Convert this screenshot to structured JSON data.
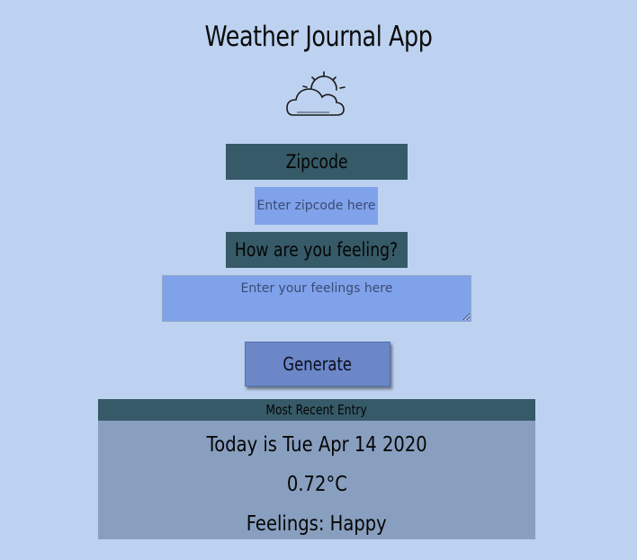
{
  "app": {
    "title": "Weather Journal App",
    "logo_icon": "partly-cloudy-icon"
  },
  "form": {
    "zip_label": "Zipcode",
    "zip_placeholder": "Enter zipcode here",
    "zip_value": "",
    "feelings_label": "How are you feeling?",
    "feelings_placeholder": "Enter your feelings here",
    "feelings_value": "",
    "generate_label": "Generate"
  },
  "entry": {
    "header": "Most Recent Entry",
    "date": "Today is Tue Apr 14 2020",
    "temp": "0.72°C",
    "content": "Feelings: Happy"
  },
  "colors": {
    "background": "#bdd2f0",
    "label_bg": "#365a67",
    "input_bg": "#7fa2ea",
    "button_bg": "#6b87c8",
    "entry_bg": "#889fbf"
  }
}
